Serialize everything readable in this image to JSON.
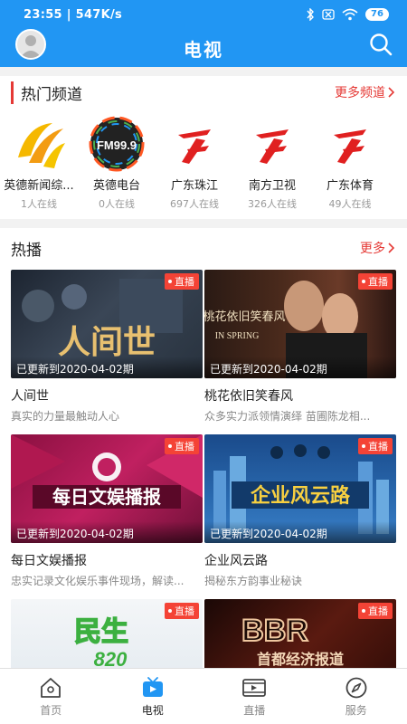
{
  "status_bar": {
    "time": "23:55",
    "speed": "547K/s",
    "battery": "76"
  },
  "header": {
    "title": "电视"
  },
  "hot_channels": {
    "title": "热门频道",
    "more_label": "更多频道",
    "items": [
      {
        "name": "英德新闻综...",
        "online": "1人在线",
        "icon": "yingde-news-logo"
      },
      {
        "name": "英德电台",
        "online": "0人在线",
        "icon": "fm999-logo",
        "logo_text": "FM99.9"
      },
      {
        "name": "广东珠江",
        "online": "697人在线",
        "icon": "guangdong-tv-logo"
      },
      {
        "name": "南方卫视",
        "online": "326人在线",
        "icon": "guangdong-tv-logo"
      },
      {
        "name": "广东体育",
        "online": "49人在线",
        "icon": "guangdong-tv-logo"
      }
    ]
  },
  "hot_play": {
    "title": "热播",
    "more_label": "更多",
    "live_label": "直播",
    "items": [
      {
        "title": "人间世",
        "desc": "真实的力量最触动人心",
        "update": "已更新到2020-04-02期",
        "poster_text": "人间世"
      },
      {
        "title": "桃花依旧笑春风",
        "desc": "众多实力派领情演绎 苗圃陈龙相...",
        "update": "已更新到2020-04-02期",
        "poster_text": "桃花依旧笑春风",
        "poster_subtext": "IN SPRING"
      },
      {
        "title": "每日文娱播报",
        "desc": "忠实记录文化娱乐事件现场，解读...",
        "update": "已更新到2020-04-02期",
        "poster_text": "每日文娱播报"
      },
      {
        "title": "企业风云路",
        "desc": "揭秘东方韵事业秘诀",
        "update": "已更新到2020-04-02期",
        "poster_text": "企业风云路"
      },
      {
        "title": "",
        "desc": "",
        "update": "",
        "poster_text": "民生",
        "poster_subtext": "820"
      },
      {
        "title": "",
        "desc": "",
        "update": "",
        "poster_text": "BBR",
        "poster_subtext": "首都经济报道"
      }
    ]
  },
  "tab_bar": {
    "items": [
      {
        "label": "首页",
        "icon": "home-icon",
        "active": false
      },
      {
        "label": "电视",
        "icon": "tv-icon",
        "active": true
      },
      {
        "label": "直播",
        "icon": "video-icon",
        "active": false
      },
      {
        "label": "服务",
        "icon": "compass-icon",
        "active": false
      }
    ]
  },
  "colors": {
    "primary": "#2196f3",
    "accent": "#e53935",
    "live_badge": "#f44336"
  }
}
